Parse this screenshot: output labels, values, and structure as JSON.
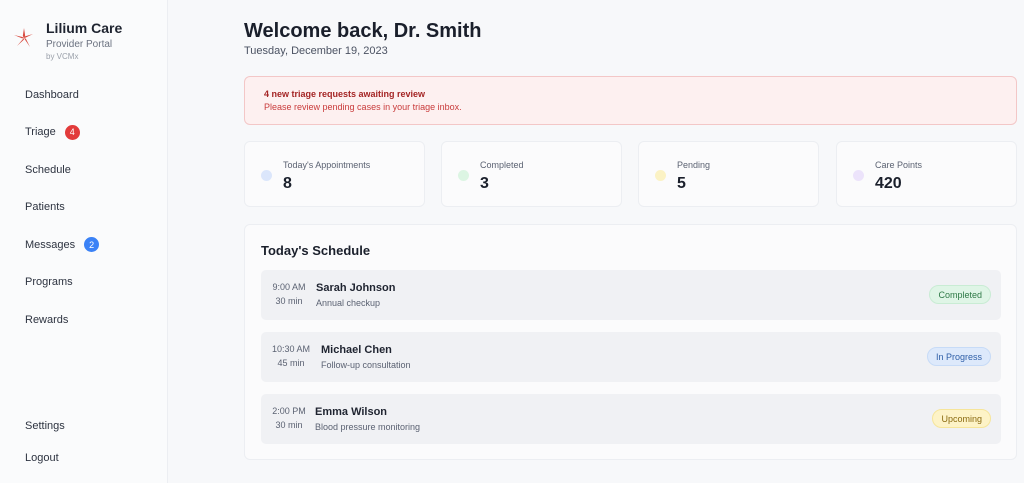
{
  "brand": {
    "name": "Lilium Care",
    "subtitle": "Provider Portal",
    "byline": "by VCMx",
    "logo_color": "#d84a3f"
  },
  "nav": {
    "items": [
      {
        "label": "Dashboard"
      },
      {
        "label": "Triage",
        "badge": "4"
      },
      {
        "label": "Schedule"
      },
      {
        "label": "Patients"
      },
      {
        "label": "Messages",
        "badge": "2"
      },
      {
        "label": "Programs"
      },
      {
        "label": "Rewards"
      }
    ],
    "bottom": [
      {
        "label": "Settings"
      },
      {
        "label": "Logout"
      }
    ]
  },
  "header": {
    "title": "Welcome back, Dr. Smith",
    "date": "Tuesday, December 19, 2023"
  },
  "alert": {
    "title": "4 new triage requests awaiting review",
    "body": "Please review pending cases in your triage inbox."
  },
  "stats": [
    {
      "label": "Today's Appointments",
      "value": "8",
      "color": "#dbe6fb"
    },
    {
      "label": "Completed",
      "value": "3",
      "color": "#dcf5e3"
    },
    {
      "label": "Pending",
      "value": "5",
      "color": "#fbf2c4"
    },
    {
      "label": "Care Points",
      "value": "420",
      "color": "#ece3fb"
    }
  ],
  "schedule": {
    "title": "Today's Schedule",
    "appointments": [
      {
        "time": "9:00 AM",
        "duration": "30 min",
        "name": "Sarah Johnson",
        "type": "Annual checkup",
        "status": "Completed"
      },
      {
        "time": "10:30 AM",
        "duration": "45 min",
        "name": "Michael Chen",
        "type": "Follow-up consultation",
        "status": "In Progress"
      },
      {
        "time": "2:00 PM",
        "duration": "30 min",
        "name": "Emma Wilson",
        "type": "Blood pressure monitoring",
        "status": "Upcoming"
      }
    ]
  }
}
